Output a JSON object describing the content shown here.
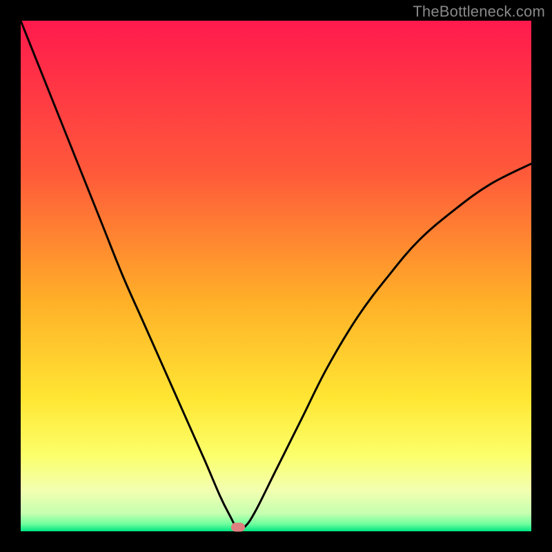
{
  "watermark": {
    "text": "TheBottleneck.com"
  },
  "chart_data": {
    "type": "line",
    "title": "",
    "xlabel": "",
    "ylabel": "",
    "xlim": [
      0,
      100
    ],
    "ylim": [
      0,
      100
    ],
    "grid": false,
    "legend": null,
    "gradient_stops": [
      {
        "offset": 0,
        "color": "#ff1a4d"
      },
      {
        "offset": 0.3,
        "color": "#ff5a3a"
      },
      {
        "offset": 0.55,
        "color": "#ffb028"
      },
      {
        "offset": 0.74,
        "color": "#ffe633"
      },
      {
        "offset": 0.85,
        "color": "#fcff6a"
      },
      {
        "offset": 0.92,
        "color": "#f2ffb0"
      },
      {
        "offset": 0.965,
        "color": "#c6ffb0"
      },
      {
        "offset": 0.985,
        "color": "#73ff9e"
      },
      {
        "offset": 1.0,
        "color": "#00e482"
      }
    ],
    "series": [
      {
        "name": "bottleneck-curve",
        "color": "#000000",
        "width": 3,
        "x": [
          0,
          4,
          8,
          12,
          16,
          20,
          24,
          28,
          32,
          36,
          39,
          41,
          42.5,
          44,
          46,
          50,
          55,
          60,
          66,
          72,
          78,
          85,
          92,
          100
        ],
        "y": [
          100,
          90,
          80,
          70,
          60,
          50,
          41,
          32,
          23,
          14,
          7,
          3,
          0.5,
          1,
          4,
          12,
          22,
          32,
          42,
          50,
          57,
          63,
          68,
          72
        ]
      }
    ],
    "marker": {
      "x": 42.5,
      "y": 0.8,
      "color": "#de807f",
      "name": "optimal-marker"
    }
  }
}
